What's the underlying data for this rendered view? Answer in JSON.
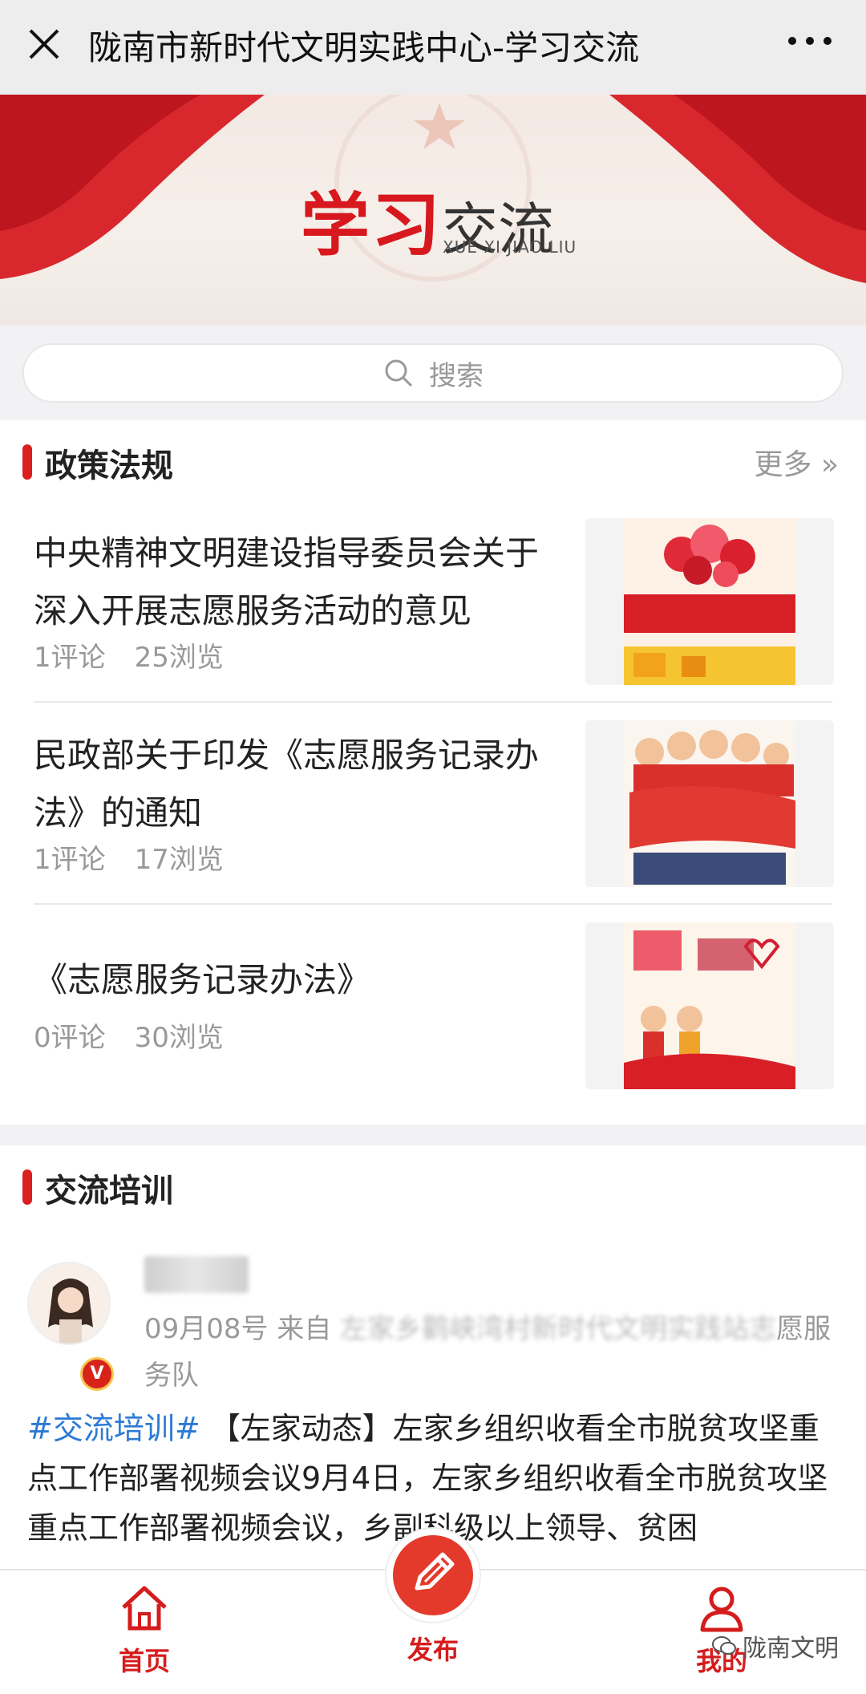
{
  "header": {
    "title": "陇南市新时代文明实践中心-学习交流"
  },
  "banner": {
    "title_red": "学习",
    "title_dark": "交流",
    "subtitle": "XUE XI JIAO LIU"
  },
  "search": {
    "placeholder": "搜索"
  },
  "policy": {
    "heading": "政策法规",
    "more": "更多 »",
    "items": [
      {
        "title": "中央精神文明建设指导委员会关于深入开展志愿服务活动的意见",
        "comments": "1评论",
        "views": "25浏览"
      },
      {
        "title": "民政部关于印发《志愿服务记录办法》的通知",
        "comments": "1评论",
        "views": "17浏览"
      },
      {
        "title": "《志愿服务记录办法》",
        "comments": "0评论",
        "views": "30浏览"
      }
    ]
  },
  "training": {
    "heading": "交流培训",
    "post": {
      "date": "09月08号 来自",
      "source_blurred": "左家乡鹳峡湾村新时代文明实践站志",
      "source_tail": "愿服务队",
      "badge": "V",
      "tag": "#交流培训#",
      "body": "【左家动态】左家乡组织收看全市脱贫攻坚重点工作部署视频会议9月4日，左家乡组织收看全市脱贫攻坚重点工作部署视频会议，乡副科级以上领导、贫困"
    }
  },
  "nav": {
    "home": "首页",
    "publish": "发布",
    "me": "我的",
    "watermark": "陇南文明"
  },
  "colors": {
    "accent": "#d9201f",
    "tag": "#2c7ad6"
  }
}
